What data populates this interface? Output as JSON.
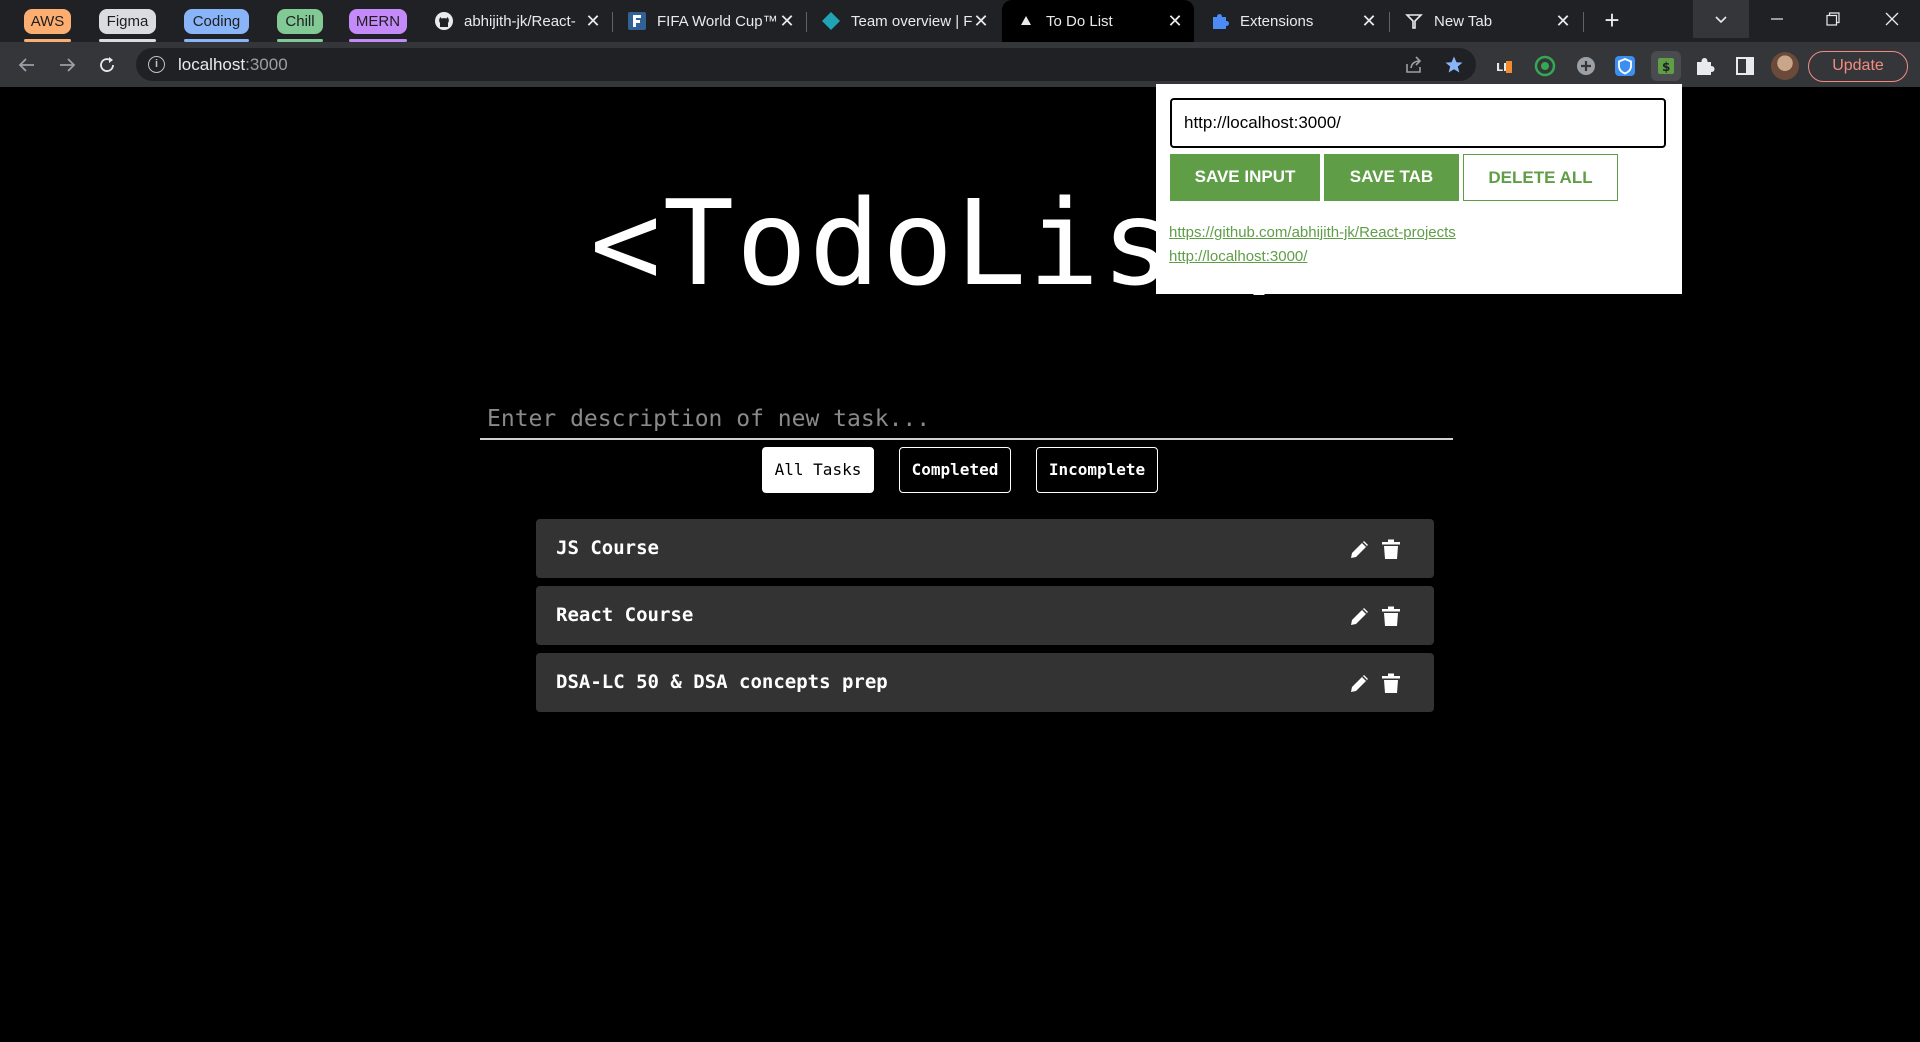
{
  "browser": {
    "tab_groups": [
      {
        "label": "AWS",
        "color": "#fcad70"
      },
      {
        "label": "Figma",
        "color": "#dadce0"
      },
      {
        "label": "Coding",
        "color": "#8ab4f8"
      },
      {
        "label": "Chill",
        "color": "#81c995"
      },
      {
        "label": "MERN",
        "color": "#c58af9"
      }
    ],
    "tabs": [
      {
        "title": "abhijith-jk/React-",
        "icon": "github-icon"
      },
      {
        "title": "FIFA World Cup™",
        "icon": "fifa-icon"
      },
      {
        "title": "Team overview | F",
        "icon": "diamond-icon"
      },
      {
        "title": "To Do List",
        "icon": "triangle-icon",
        "active": true
      },
      {
        "title": "Extensions",
        "icon": "puzzle-icon"
      },
      {
        "title": "New Tab",
        "icon": "newtab-icon"
      }
    ],
    "close_glyph": "✕",
    "new_tab_glyph": "+",
    "address": {
      "host": "localhost",
      "port": ":3000"
    },
    "update_label": "Update",
    "lighthouse_label": "LH"
  },
  "app": {
    "title": "<TodoList/>",
    "input_placeholder": "Enter description of new task...",
    "filters": [
      "All Tasks",
      "Completed",
      "Incomplete"
    ],
    "active_filter": "All Tasks",
    "tasks": [
      "JS Course",
      "React Course",
      "DSA-LC 50 & DSA concepts prep"
    ]
  },
  "popup": {
    "input_value": "http://localhost:3000/",
    "save_input_label": "SAVE INPUT",
    "save_tab_label": "SAVE TAB",
    "delete_all_label": "DELETE ALL",
    "links": [
      "https://github.com/abhijith-jk/React-projects",
      "http://localhost:3000/"
    ],
    "accent": "#5f9e47"
  }
}
